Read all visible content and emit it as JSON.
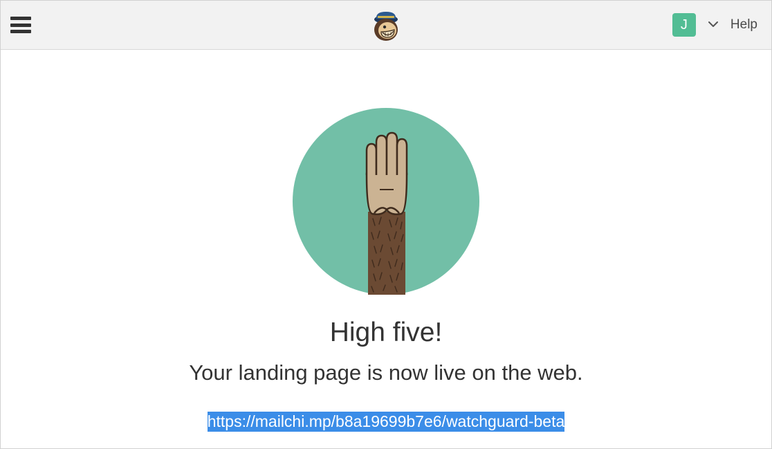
{
  "header": {
    "avatar_initial": "J",
    "help_label": "Help"
  },
  "main": {
    "title": "High five!",
    "subtitle": "Your landing page is now live on the web.",
    "url": "https://mailchi.mp/b8a19699b7e6/watchguard-beta"
  }
}
